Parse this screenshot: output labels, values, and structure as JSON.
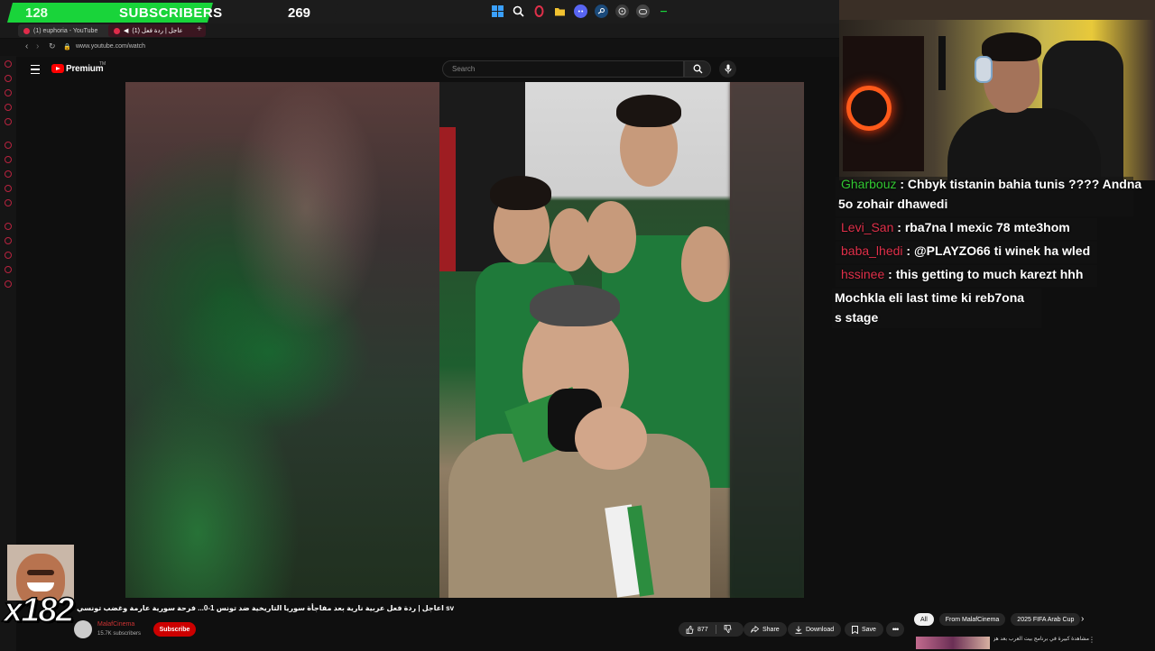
{
  "overlay": {
    "sub_count": "128",
    "sub_label": "SUBSCRIBERS",
    "sub_goal": "269",
    "emote_combo": "x182"
  },
  "taskbar": {
    "icons": [
      "windows-icon",
      "search-icon",
      "opera-gx-icon",
      "file-explorer-icon",
      "discord-icon",
      "steam-icon",
      "obs-icon",
      "controller-icon",
      "minus-icon"
    ]
  },
  "browser": {
    "tabs": [
      {
        "label": "(1) euphoria - YouTube",
        "active": false
      },
      {
        "label": "(1) عاجل | ردة فعل",
        "active": true
      }
    ],
    "url": "www.youtube.com/watch"
  },
  "youtube": {
    "premium_label": "Premium",
    "premium_tm": "TM",
    "search_placeholder": "Search",
    "video_title": "sv اعاجل | ردة فعل عربية نارية بعد مفاجأة سوريا التاريخية ضد تونس 1-0... فرحة سورية عارمة وغضب تونسي",
    "channel": {
      "name": "MalafCinema",
      "subscribers": "15.7K subscribers"
    },
    "subscribe_label": "Subscribe",
    "likes": "877",
    "share_label": "Share",
    "download_label": "Download",
    "save_label": "Save",
    "chips": [
      "All",
      "From MalafCinema",
      "2025 FIFA Arab Cup"
    ],
    "rec_title": "مشاهدة كبيرة في برنامج بيت العرب بعد هزيمة"
  },
  "chat": {
    "messages": [
      {
        "user": "Gharbouz",
        "user_color": "#32c832",
        "text": ": Chbyk tistanin bahia tunis ???? Andna"
      },
      {
        "user": "",
        "user_color": "#ffffff",
        "text": "5o zohair dhawedi"
      },
      {
        "user": "Levi_San",
        "user_color": "#e0304a",
        "text": ": rba7na l mexic 78 mte3hom"
      },
      {
        "user": "baba_lhedi",
        "user_color": "#e0304a",
        "text": ": @PLAYZO66 ti winek ha wled"
      },
      {
        "user": "hssinee",
        "user_color": "#e0304a",
        "text": ": this getting to much karezt hhh"
      },
      {
        "user": "",
        "user_color": "#ffffff",
        "text": "Mochkla eli last time ki reb7ona"
      },
      {
        "user": "",
        "user_color": "#ffffff",
        "text": "s stage"
      }
    ]
  },
  "colors": {
    "accent_green": "#19d43a",
    "youtube_red": "#ff0000",
    "subscribe_red": "#cc0000"
  }
}
